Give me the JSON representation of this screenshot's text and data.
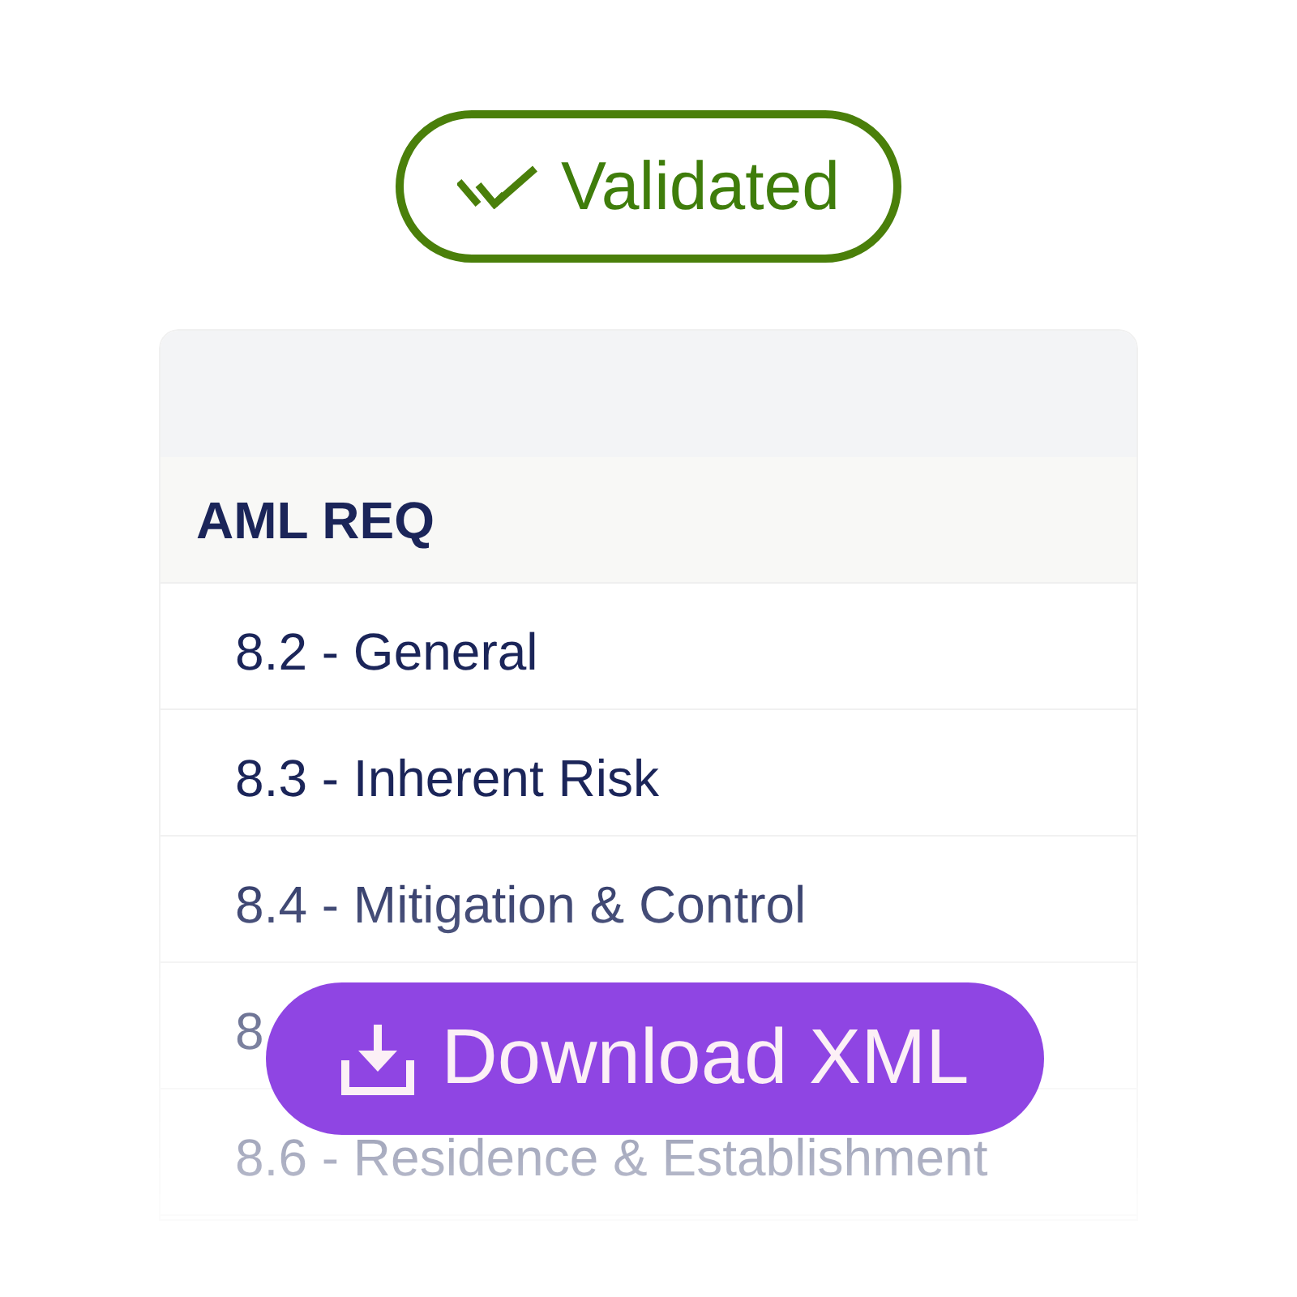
{
  "status_badge": {
    "label": "Validated"
  },
  "panel": {
    "section": {
      "title": "AML REQ",
      "items": [
        {
          "label": "8.2 - General"
        },
        {
          "label": "8.3 - Inherent Risk"
        },
        {
          "label": "8.4 - Mitigation & Control"
        },
        {
          "label": "8"
        },
        {
          "label": "8.6 - Residence & Establishment"
        }
      ]
    }
  },
  "download_button": {
    "label": "Download XML"
  }
}
